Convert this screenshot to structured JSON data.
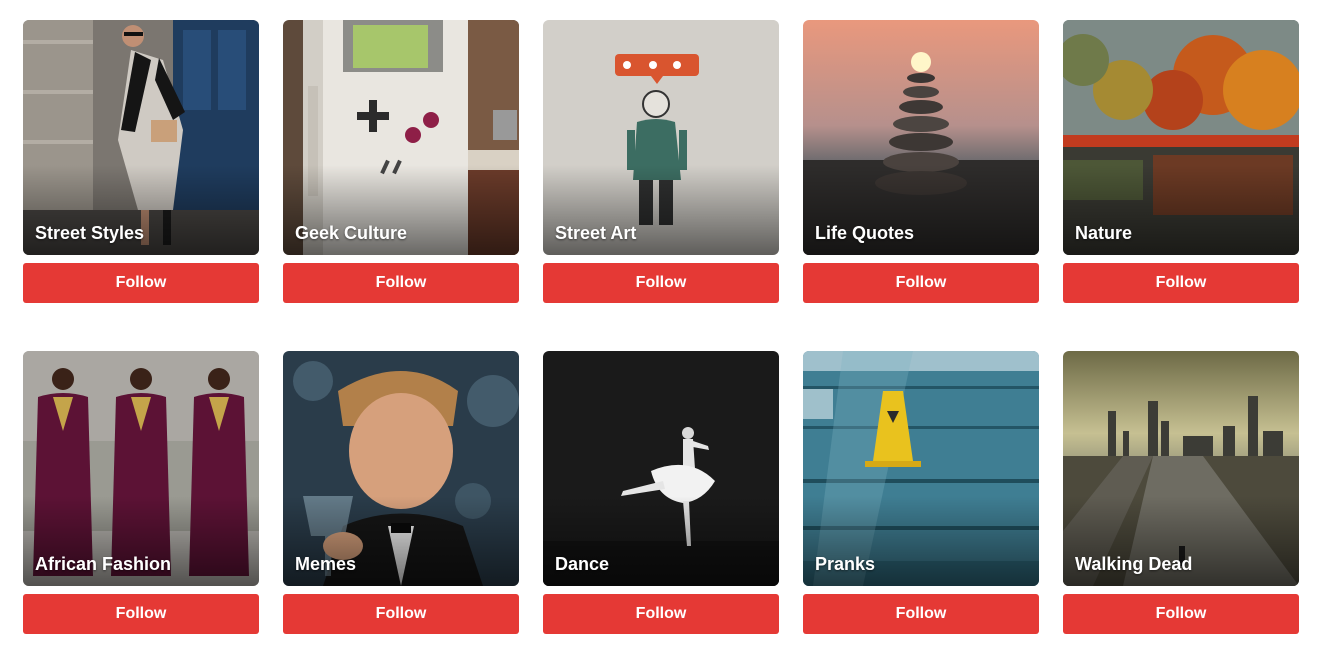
{
  "colors": {
    "follow_button": "#e53935"
  },
  "topics": [
    {
      "title": "Street Styles",
      "follow_label": "Follow",
      "image": "woman-walking-street-photo"
    },
    {
      "title": "Geek Culture",
      "follow_label": "Follow",
      "image": "gameboy-fridge-photo"
    },
    {
      "title": "Street Art",
      "follow_label": "Follow",
      "image": "graffiti-child-wall-photo"
    },
    {
      "title": "Life Quotes",
      "follow_label": "Follow",
      "image": "stacked-stones-sunset-photo"
    },
    {
      "title": "Nature",
      "follow_label": "Follow",
      "image": "autumn-lake-photo"
    },
    {
      "title": "African Fashion",
      "follow_label": "Follow",
      "image": "women-in-dresses-photo"
    },
    {
      "title": "Memes",
      "follow_label": "Follow",
      "image": "man-raising-glass-photo"
    },
    {
      "title": "Dance",
      "follow_label": "Follow",
      "image": "ballerina-dark-photo"
    },
    {
      "title": "Pranks",
      "follow_label": "Follow",
      "image": "wet-floor-sign-pool-photo"
    },
    {
      "title": "Walking Dead",
      "follow_label": "Follow",
      "image": "abandoned-city-highway-photo"
    }
  ]
}
